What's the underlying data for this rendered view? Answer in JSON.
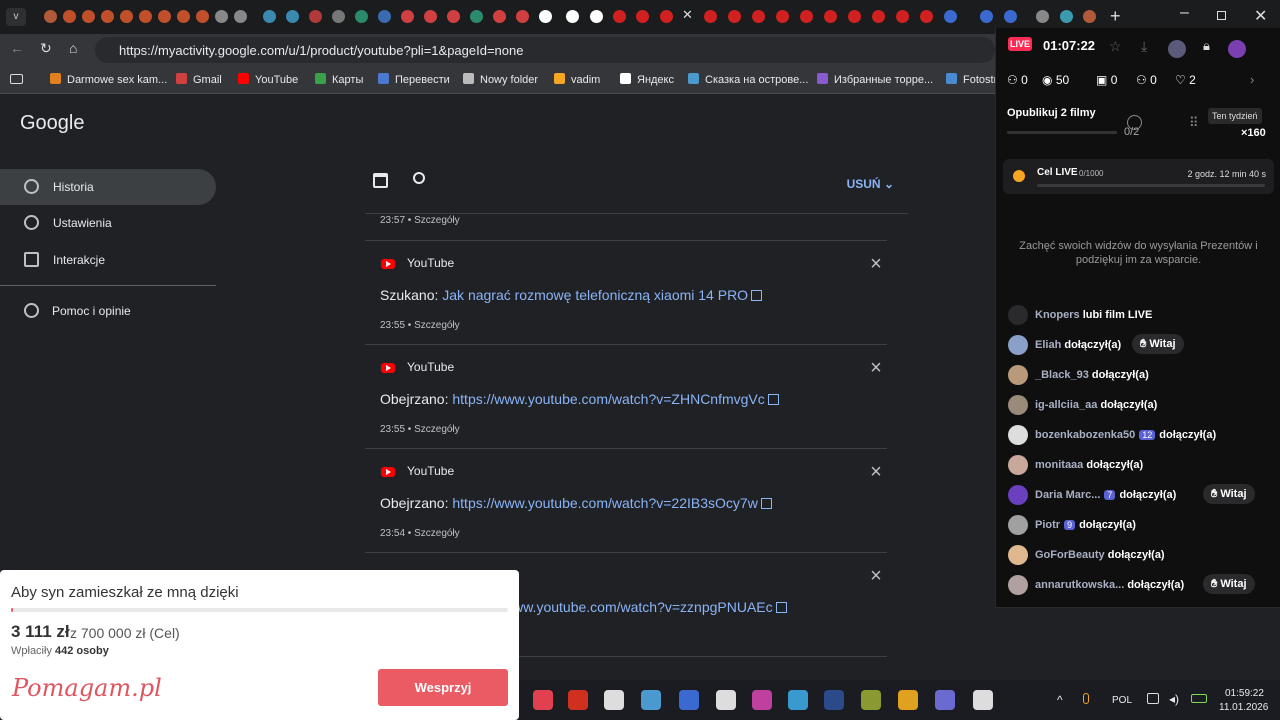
{
  "browser": {
    "url": "https://myactivity.google.com/u/1/product/youtube?pli=1&pageId=none",
    "bookmarks": [
      "Darmowe sex kam...",
      "Gmail",
      "YouTube",
      "Карты",
      "Перевести",
      "Nowy folder",
      "vadim",
      "Яндекс",
      "Сказка на острове...",
      "Избранные торре...",
      "Fotostrana"
    ]
  },
  "sidebar": {
    "logo": "Google",
    "items": [
      "Historia",
      "Ustawienia",
      "Interakcje",
      "Pomoc i opinie"
    ]
  },
  "toolbar": {
    "delete_label": "USUŃ"
  },
  "activity": {
    "top_meta": "23:57 • Szczegóły",
    "cards": [
      {
        "source": "YouTube",
        "verb": "Szukano:",
        "link": "Jak nagrać rozmowę telefoniczną xiaomi 14 PRO",
        "meta": "23:55 • Szczegóły"
      },
      {
        "source": "YouTube",
        "verb": "Obejrzano:",
        "link": "https://www.youtube.com/watch?v=ZHNCnfmvgVc",
        "meta": "23:55 • Szczegóły"
      },
      {
        "source": "YouTube",
        "verb": "Obejrzano:",
        "link": "https://www.youtube.com/watch?v=22IB3sOcy7w",
        "meta": "23:54 • Szczegóły"
      },
      {
        "source": "YouTube",
        "verb": "",
        "link": "www.youtube.com/watch?v=zznpgPNUAEc",
        "meta": ""
      }
    ]
  },
  "pomagam": {
    "title": "Aby syn zamieszkał ze mną dzięki",
    "raised": "3 111 zł",
    "goal": "z 700 000 zł (Cel)",
    "payments_label": "Wpłaciły",
    "payments_count": "442 osoby",
    "logo": "Pomagam.pl",
    "button": "Wesprzyj",
    "progress_fraction": 0.0044
  },
  "live": {
    "badge": "LIVE",
    "timer": "01:07:22",
    "stats": {
      "a": "0",
      "viewers": "50",
      "gifts": "0",
      "follows": "0",
      "likes": "2"
    },
    "publish_title": "Opublikuj 2 filmy",
    "publish_count": "0/2",
    "week_label": "Ten tydzień",
    "multiplier": "×160",
    "goal_title": "Cel LIVE",
    "goal_count": "0/1000",
    "goal_time": "2 godz. 12 min 40 s",
    "encourage": "Zachęć swoich widzów do wysyłania Prezentów i podziękuj im za wsparcie.",
    "chat": [
      {
        "name": "Knopers",
        "badge": "",
        "action": "lubi film LIVE",
        "witaj": "",
        "color": "#ffffff"
      },
      {
        "name": "Eliah",
        "badge": "",
        "action": "dołączył(a)",
        "witaj": "Witaj",
        "color": "#8aa0c8"
      },
      {
        "name": "_Black_93",
        "badge": "",
        "action": "dołączył(a)",
        "witaj": "",
        "color": "#b89a7a"
      },
      {
        "name": "ig-allciia_aa",
        "badge": "",
        "action": "dołączył(a)",
        "witaj": "",
        "color": "#9a8a7a"
      },
      {
        "name": "bozenkabozenka50",
        "badge": "12",
        "action": "dołączył(a)",
        "witaj": "",
        "color": "#dddddd"
      },
      {
        "name": "monitaaa",
        "badge": "",
        "action": "dołączył(a)",
        "witaj": "",
        "color": "#c8a89a"
      },
      {
        "name": "Daria Marc...",
        "badge": "7",
        "action": "dołączył(a)",
        "witaj": "Witaj",
        "color": "#6a3fc0"
      },
      {
        "name": "Piotr",
        "badge": "9",
        "action": "dołączył(a)",
        "witaj": "",
        "color": "#a0a0a0"
      },
      {
        "name": "GoForBeauty",
        "badge": "",
        "action": "dołączył(a)",
        "witaj": "",
        "color": "#e0b890"
      },
      {
        "name": "annarutkowska...",
        "badge": "",
        "action": "dołączył(a)",
        "witaj": "Witaj",
        "color": "#b0a0a0"
      }
    ]
  },
  "taskbar": {
    "lang": "POL",
    "time": "01:59:22",
    "date": "11.01.2026"
  }
}
